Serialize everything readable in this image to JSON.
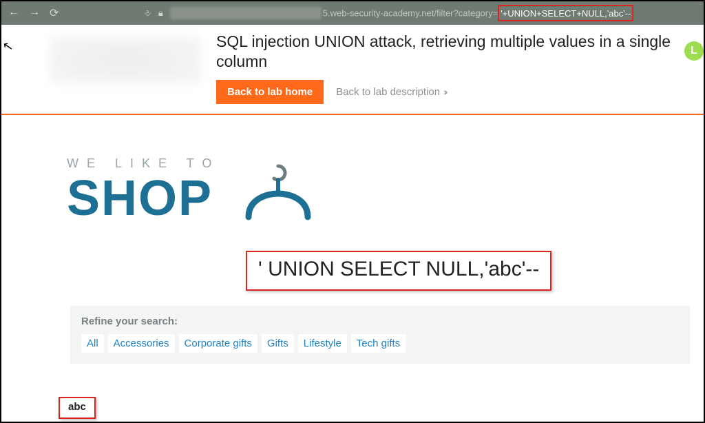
{
  "chrome": {
    "url_visible": "5.web-security-academy.net",
    "url_path": "/filter?category=",
    "url_query_highlight": "'+UNION+SELECT+NULL,'abc'--"
  },
  "header": {
    "title": "SQL injection UNION attack, retrieving multiple values in a single column",
    "back_home": "Back to lab home",
    "back_desc": "Back to lab description",
    "badge": "L"
  },
  "brand": {
    "tagline": "WE LIKE TO",
    "name": "SHOP"
  },
  "sql_overlay": "' UNION SELECT NULL,'abc'--",
  "filter": {
    "refine": "Refine your search:",
    "tags": [
      "All",
      "Accessories",
      "Corporate gifts",
      "Gifts",
      "Lifestyle",
      "Tech gifts"
    ]
  },
  "result": "abc"
}
